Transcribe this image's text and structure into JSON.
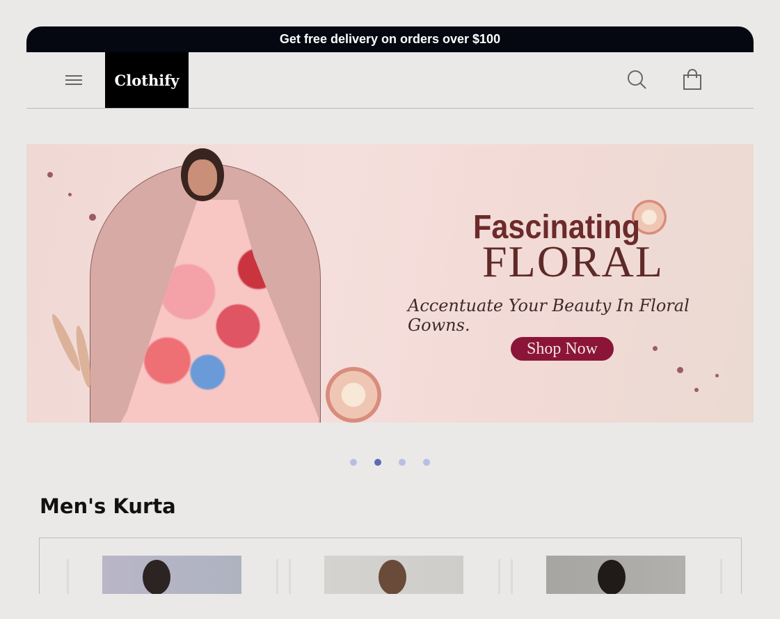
{
  "announcement": {
    "text": "Get free delivery on orders over $100"
  },
  "header": {
    "logo_text": "Clothify",
    "menu_icon": "hamburger-menu-icon",
    "search_icon": "search-icon",
    "cart_icon": "shopping-bag-icon"
  },
  "banner": {
    "title_line1": "Fascinating",
    "title_line2": "FLORAL",
    "subtitle": "Accentuate Your Beauty In Floral Gowns.",
    "cta_label": "Shop Now"
  },
  "carousel": {
    "slide_count": 4,
    "active_index": 1
  },
  "section": {
    "title": "Men's Kurta"
  },
  "colors": {
    "announcement_bg": "#050811",
    "page_bg": "#eae9e7",
    "cta_bg": "#8b1538",
    "dot_active": "#5a6bb8",
    "dot_inactive": "#b6bfe3"
  }
}
